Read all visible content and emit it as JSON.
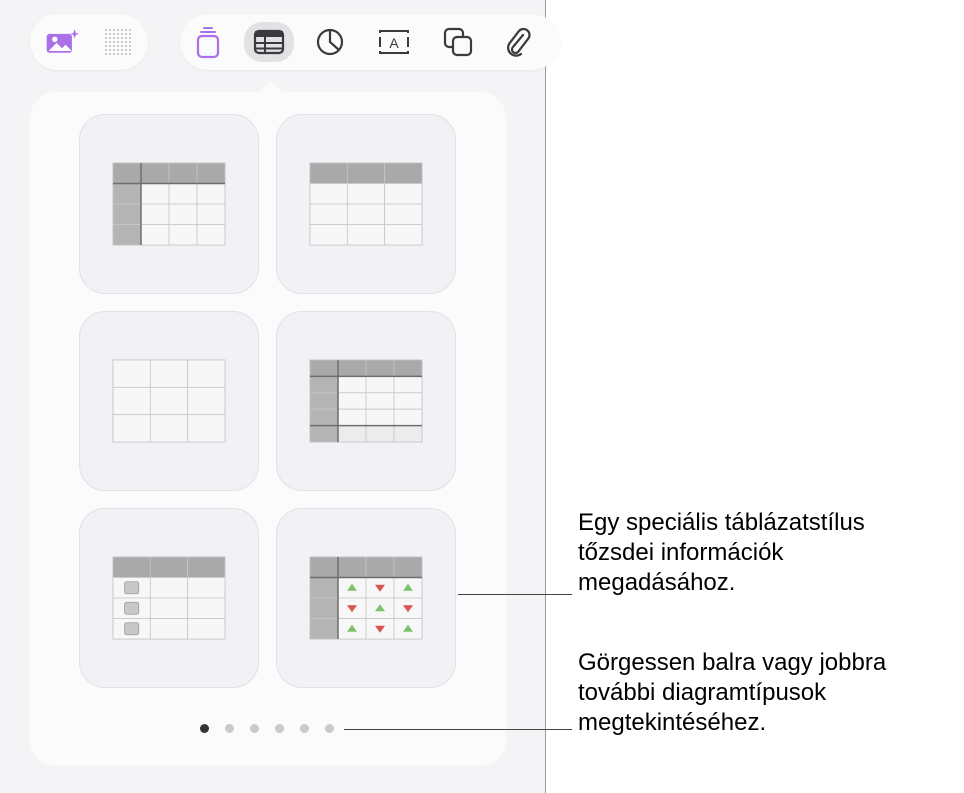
{
  "toolbar": {
    "left_group": [
      {
        "icon": "image-playground-icon",
        "color": "#a970e8"
      },
      {
        "icon": "dot-grid-icon",
        "color": "#bdbdc2"
      }
    ],
    "right_group": [
      {
        "icon": "text-box-icon",
        "color": "#a970e8"
      },
      {
        "icon": "table-icon",
        "color": "#3a3a3c",
        "selected": true
      },
      {
        "icon": "chart-icon",
        "color": "#3a3a3c"
      },
      {
        "icon": "text-field-icon",
        "color": "#3a3a3c",
        "glyph": "A"
      },
      {
        "icon": "shapes-icon",
        "color": "#3a3a3c"
      },
      {
        "icon": "paperclip-icon",
        "color": "#3a3a3c"
      }
    ]
  },
  "table_styles": [
    {
      "name": "table-style-header-row-column"
    },
    {
      "name": "table-style-header-row"
    },
    {
      "name": "table-style-plain"
    },
    {
      "name": "table-style-header-footer"
    },
    {
      "name": "table-style-checklist"
    },
    {
      "name": "table-style-stocks"
    }
  ],
  "pagination": {
    "pages": 6,
    "current": 1
  },
  "callouts": {
    "stocks_table": "Egy speciális táblázatstílus\ntőzsdei információk\nmegadásához.",
    "page_dots": "Görgessen balra vagy jobbra\ntovábbi diagramtípusok\nmegtekintéséhez."
  },
  "colors": {
    "accent_purple": "#a970e8",
    "arrow_up": "#7cc26a",
    "arrow_down": "#d9534f"
  }
}
